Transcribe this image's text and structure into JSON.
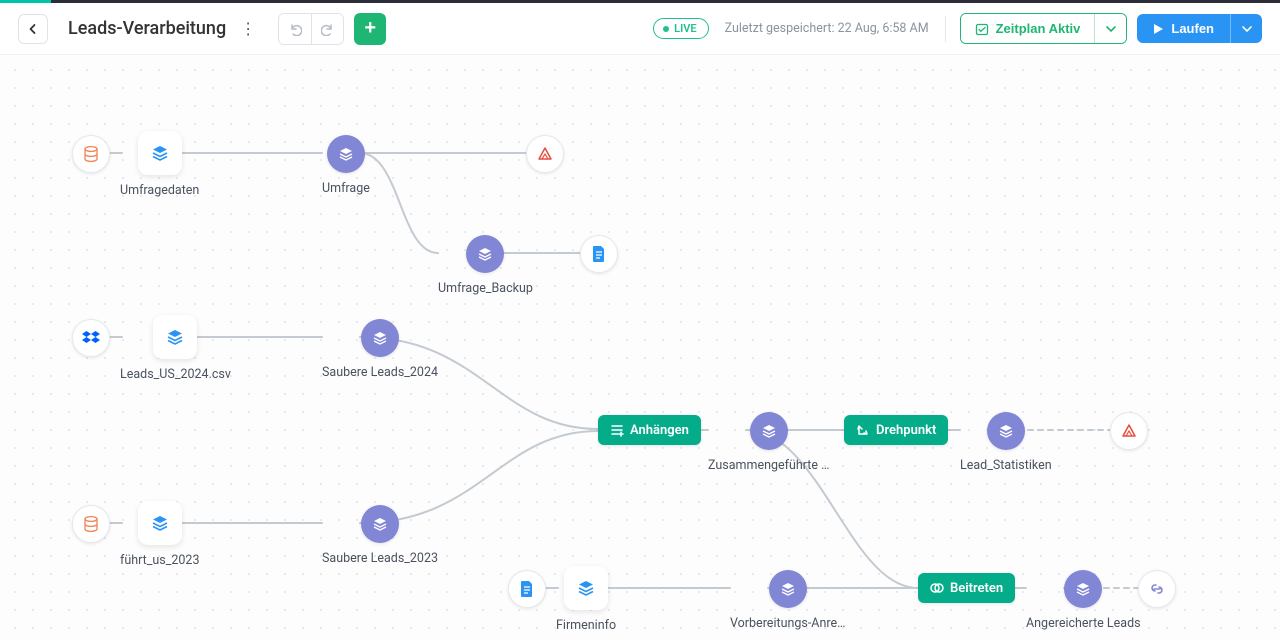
{
  "header": {
    "title": "Leads-Verarbeitung",
    "live_badge": "LIVE",
    "saved_prefix": "Zuletzt gespeichert: ",
    "saved_time": "22 Aug, 6:58 AM",
    "schedule_label": "Zeitplan Aktiv",
    "run_label": "Laufen"
  },
  "colors": {
    "accent_green": "#1fb673",
    "accent_teal": "#05ac8a",
    "accent_blue": "#2a94f4",
    "node_purple": "#8186d5"
  },
  "nodes": {
    "src_survey_db": {
      "label": "",
      "icon": "database",
      "type": "source-icon"
    },
    "umfragedaten": {
      "label": "Umfragedaten",
      "icon": "layers-blue",
      "type": "card"
    },
    "umfrage": {
      "label": "Umfrage",
      "icon": "layers",
      "type": "purple"
    },
    "umfrage_output": {
      "label": "",
      "icon": "triangle-red",
      "type": "endpoint"
    },
    "umfrage_backup": {
      "label": "Umfrage_Backup",
      "icon": "layers",
      "type": "purple"
    },
    "doc_out": {
      "label": "",
      "icon": "doc-blue",
      "type": "endpoint"
    },
    "src_dropbox": {
      "label": "",
      "icon": "dropbox",
      "type": "source-icon"
    },
    "leads_us_2024": {
      "label": "Leads_US_2024.csv",
      "icon": "layers-blue",
      "type": "card"
    },
    "saubere_2024": {
      "label": "Saubere Leads_2024",
      "icon": "layers",
      "type": "purple"
    },
    "src_db2": {
      "label": "",
      "icon": "database-red",
      "type": "source-icon"
    },
    "leads_us_2023": {
      "label": "führt_us_2023",
      "icon": "layers-blue",
      "type": "card"
    },
    "saubere_2023": {
      "label": "Saubere Leads_2023",
      "icon": "layers",
      "type": "purple"
    },
    "append": {
      "label": "Anhängen",
      "icon": "append",
      "type": "pill"
    },
    "merged": {
      "label": "Zusammengeführte …",
      "icon": "layers",
      "type": "purple"
    },
    "pivot": {
      "label": "Drehpunkt",
      "icon": "pivot",
      "type": "pill"
    },
    "lead_stats": {
      "label": "Lead_Statistiken",
      "icon": "layers",
      "type": "purple"
    },
    "stats_out": {
      "label": "",
      "icon": "triangle-red",
      "type": "endpoint"
    },
    "doc_src": {
      "label": "",
      "icon": "doc-blue",
      "type": "source-icon"
    },
    "firmeninfo": {
      "label": "Firmeninfo",
      "icon": "layers-blue",
      "type": "card"
    },
    "prep_enrich": {
      "label": "Vorbereitungs-Anre…",
      "icon": "layers",
      "type": "purple"
    },
    "join": {
      "label": "Beitreten",
      "icon": "join",
      "type": "pill"
    },
    "enriched": {
      "label": "Angereicherte Leads",
      "icon": "layers",
      "type": "purple"
    },
    "link_out": {
      "label": "",
      "icon": "link",
      "type": "endpoint"
    }
  }
}
